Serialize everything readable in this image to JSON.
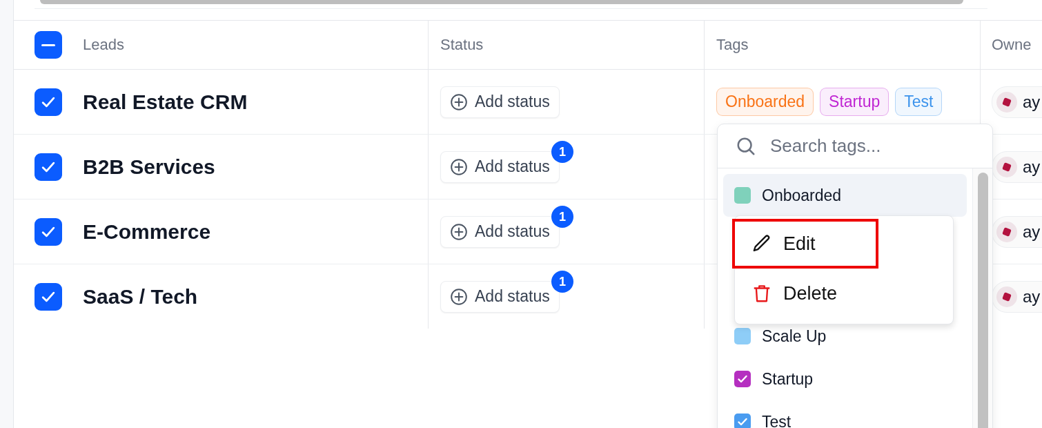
{
  "table": {
    "select_all": {
      "indeterminate": true
    },
    "columns": [
      "Leads",
      "Status",
      "Tags",
      "Owne"
    ],
    "rows": [
      {
        "checked": true,
        "name": "Real Estate CRM",
        "status_label": "Add status",
        "status_badge": "",
        "tags": [
          {
            "label": "Onboarded",
            "color": "#f97316"
          },
          {
            "label": "Startup",
            "color": "#c026d3"
          },
          {
            "label": "Test",
            "color": "#3b93ec"
          }
        ],
        "owner": "ay"
      },
      {
        "checked": true,
        "name": "B2B Services",
        "status_label": "Add status",
        "status_badge": "1",
        "tags": [],
        "owner": "ay"
      },
      {
        "checked": true,
        "name": "E-Commerce",
        "status_label": "Add status",
        "status_badge": "1",
        "tags": [],
        "owner": "ay"
      },
      {
        "checked": true,
        "name": "SaaS / Tech",
        "status_label": "Add status",
        "status_badge": "1",
        "tags": [],
        "owner": "ay"
      }
    ]
  },
  "tag_dropdown": {
    "search": {
      "placeholder": "Search tags..."
    },
    "items": [
      {
        "label": "Onboarded",
        "color": "#7fd1bb",
        "checked": false,
        "hovered": true
      },
      {
        "label": "Scale Up",
        "color": "#8ecdf7",
        "checked": false,
        "hovered": false
      },
      {
        "label": "Startup",
        "color": "#b52fc0",
        "checked": true,
        "hovered": false
      },
      {
        "label": "Test",
        "color": "#4a9cf0",
        "checked": true,
        "hovered": false
      }
    ],
    "context_menu": {
      "items": [
        {
          "kind": "edit",
          "label": "Edit",
          "highlighted": true
        },
        {
          "kind": "delete",
          "label": "Delete",
          "highlighted": false
        }
      ]
    }
  }
}
